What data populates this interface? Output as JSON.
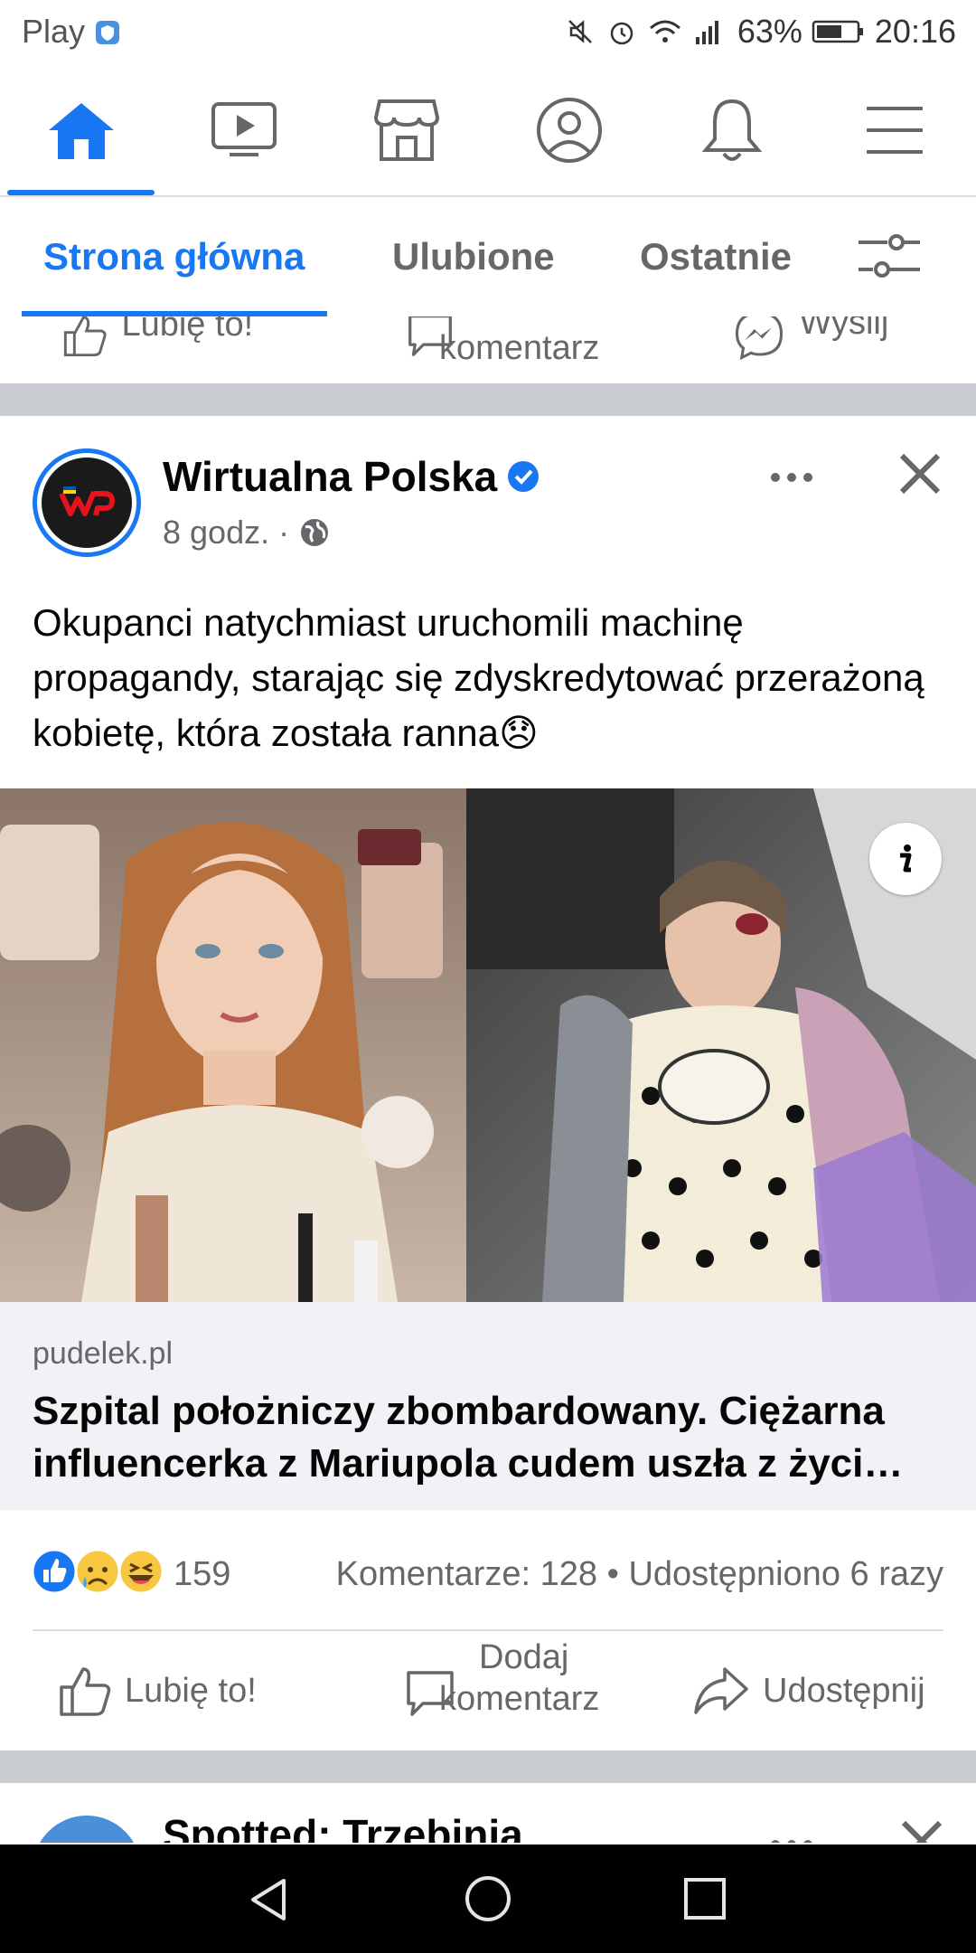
{
  "status_bar": {
    "carrier": "Play",
    "battery": "63%",
    "time": "20:16"
  },
  "top_nav": {
    "items": [
      "home-icon",
      "watch-icon",
      "marketplace-icon",
      "profile-icon",
      "notifications-icon",
      "menu-icon"
    ],
    "active": "home",
    "accent": "#1877f2"
  },
  "tabs": {
    "items": [
      "Strona główna",
      "Ulubione",
      "Ostatnie"
    ],
    "active_index": 0
  },
  "prev_post_actions": {
    "like": "Lubię to!",
    "comment": "komentarz",
    "send": "Wyślij"
  },
  "post": {
    "page_name": "Wirtualna Polska",
    "verified": true,
    "time": "8 godz.",
    "audience_icon": "globe-icon",
    "text": "Okupanci natychmiast uruchomili machinę propagandy, starając się zdyskredytować przerażoną kobietę, która została ranna😞",
    "link": {
      "domain": "pudelek.pl",
      "title": "Szpital położniczy zbombardowany. Ciężarna influencerka z Mariupola cudem uszła z życi…"
    },
    "reactions": {
      "icons": [
        "like-reaction-icon",
        "sad-reaction-icon",
        "haha-reaction-icon"
      ],
      "count": "159",
      "comments": "Komentarze: 128",
      "shares": "Udostępniono 6 razy"
    },
    "actions": {
      "like": "Lubię to!",
      "comment_line1": "Dodaj",
      "comment_line2": "komentarz",
      "share": "Udostępnij"
    }
  },
  "next_post": {
    "page_name": "Spotted: Trzebinia"
  }
}
